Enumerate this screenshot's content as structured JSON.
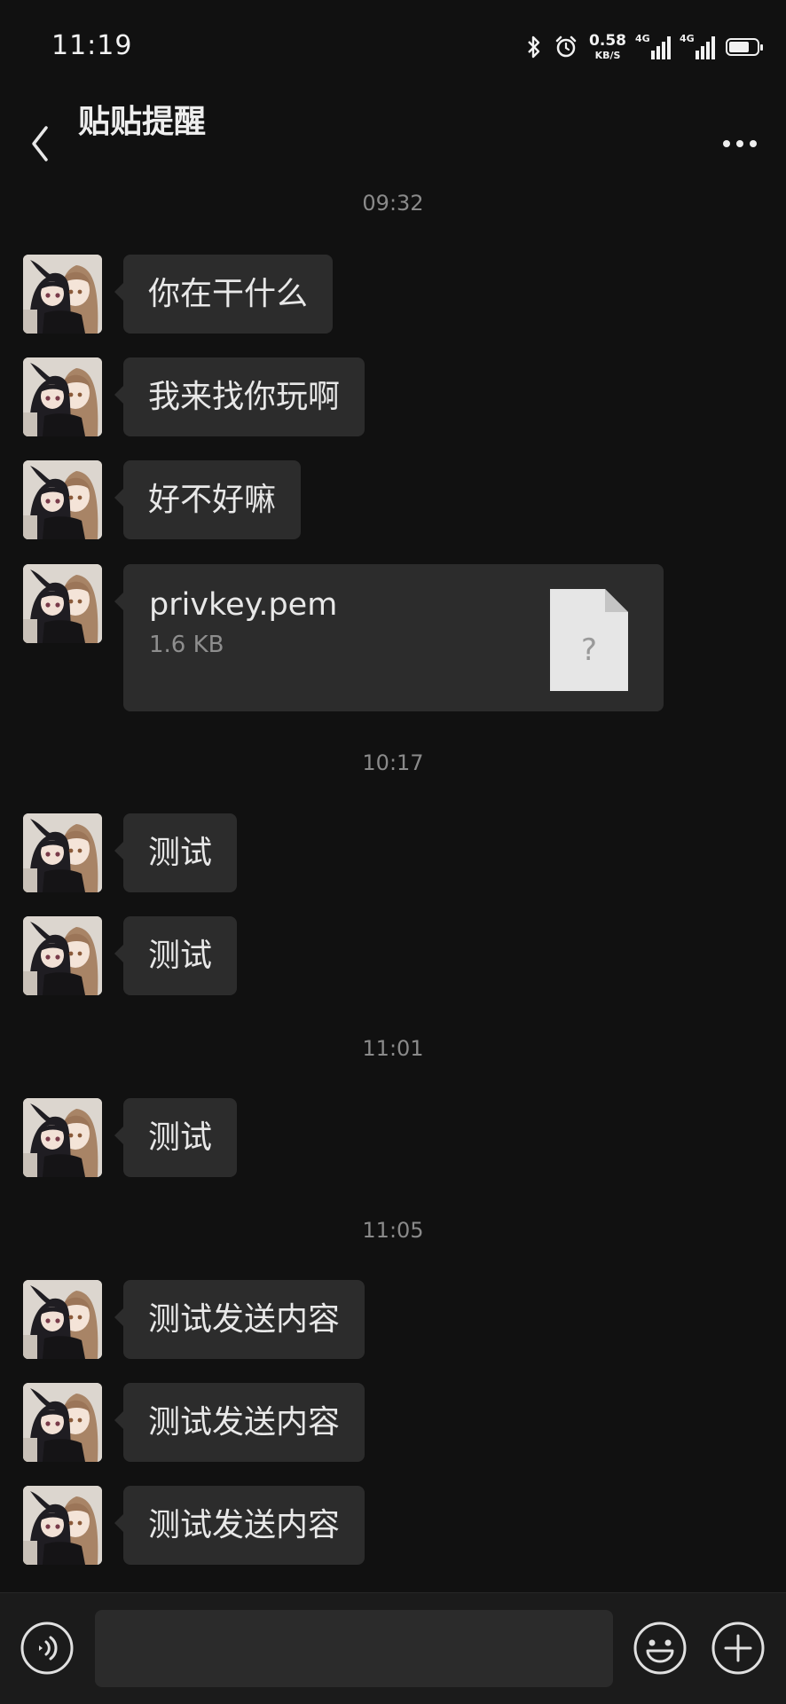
{
  "status_bar": {
    "time": "11:19",
    "net_speed_value": "0.58",
    "net_speed_unit": "KB/S",
    "sim1_label": "4G",
    "sim2_label": "4G",
    "battery_level": 0.75
  },
  "header": {
    "title": "贴贴提醒",
    "back_icon": "chevron-left-icon",
    "more_icon": "more-dots-icon"
  },
  "messages": {
    "stamp_1": "09:32",
    "msg_1": "你在干什么",
    "msg_2": "我来找你玩啊",
    "msg_3": "好不好嘛",
    "file": {
      "name": "privkey.pem",
      "size": "1.6 KB",
      "icon": "unknown-file-icon",
      "icon_glyph": "?"
    },
    "stamp_2": "10:17",
    "msg_5": "测试",
    "msg_6": "测试",
    "stamp_3": "11:01",
    "msg_7": "测试",
    "stamp_4": "11:05",
    "msg_8": "测试发送内容",
    "msg_9": "测试发送内容",
    "msg_10": "测试发送内容"
  },
  "input_bar": {
    "value": "",
    "voice_icon": "voice-input-icon",
    "emoji_icon": "emoji-icon",
    "plus_icon": "plus-icon"
  },
  "colors": {
    "background": "#111111",
    "bubble": "#2c2c2c",
    "input_bar": "#1b1b1b",
    "text": "#e8e8e8",
    "timestamp": "#8a8a8a"
  }
}
